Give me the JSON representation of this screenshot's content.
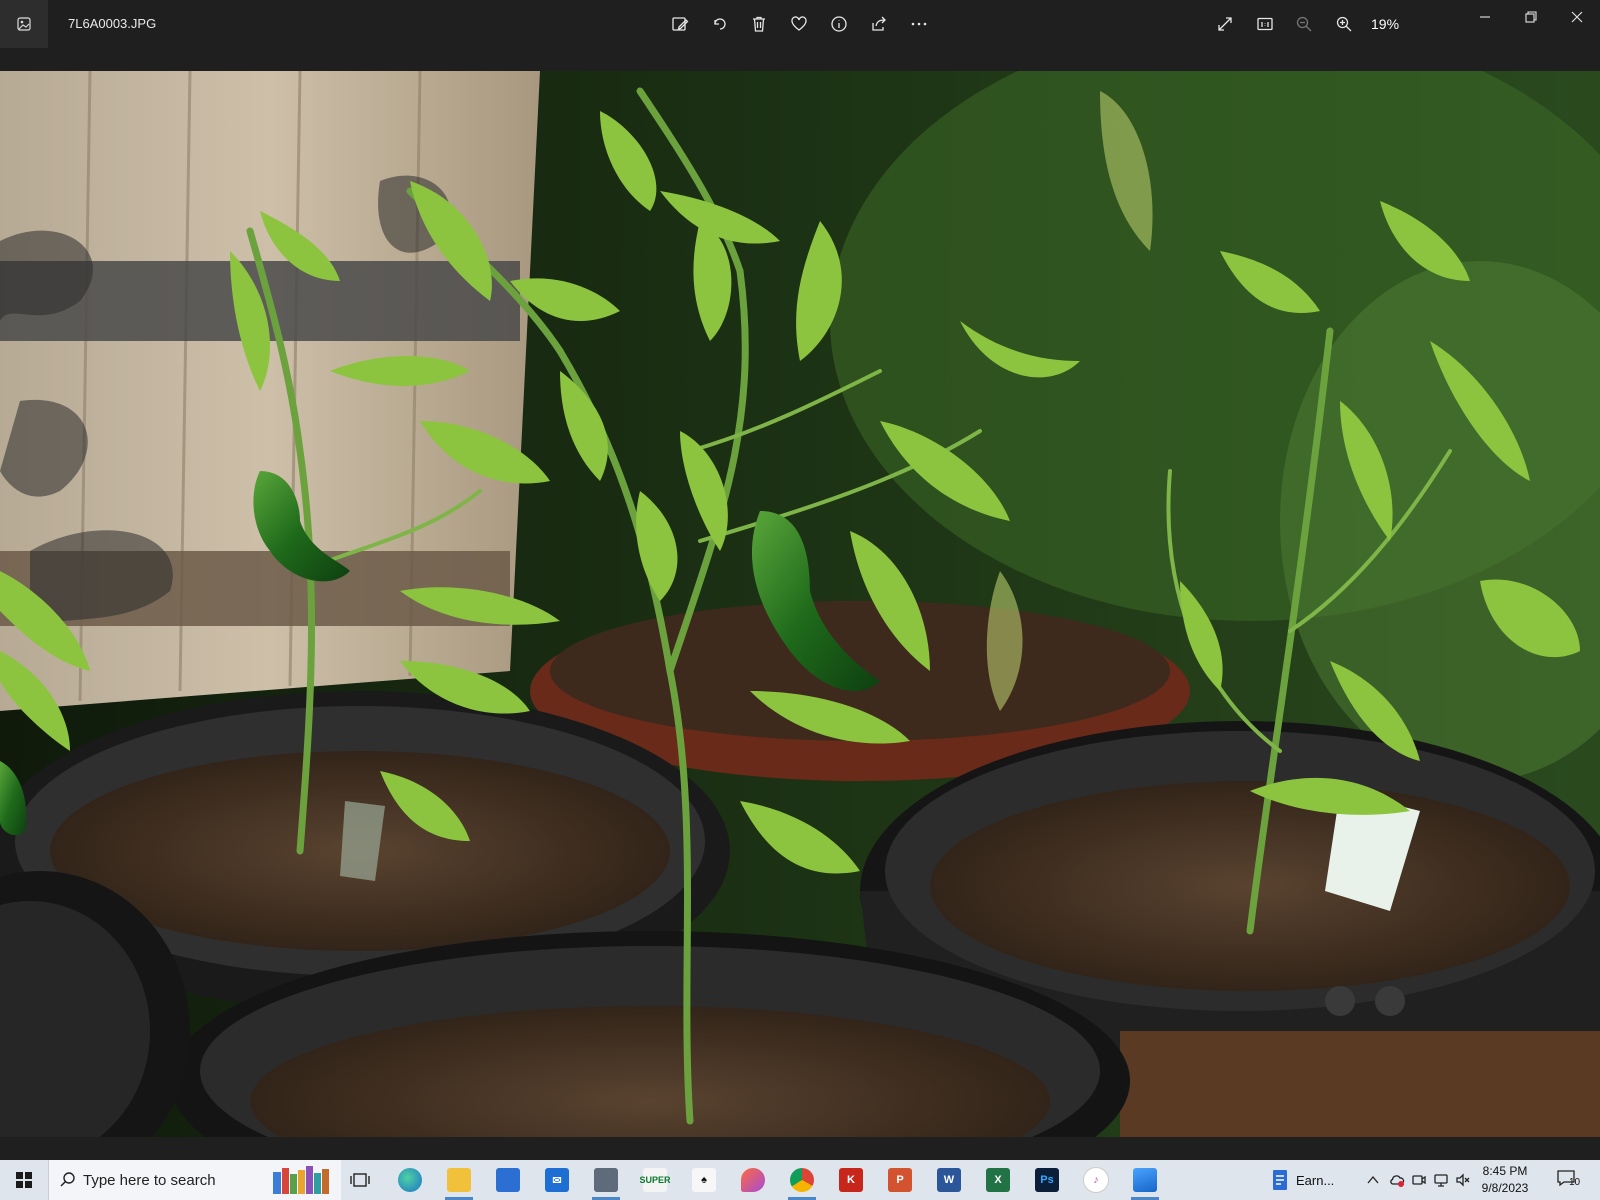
{
  "window": {
    "file_name": "7L6A0003.JPG",
    "zoom_level": "19%"
  },
  "toolbar": {
    "commands": [
      "edit-image",
      "rotate",
      "delete",
      "favorite",
      "file-info",
      "share",
      "see-more"
    ],
    "view_commands": [
      "full-screen",
      "actual-size",
      "zoom-out",
      "zoom-in"
    ]
  },
  "taskbar": {
    "search_placeholder": "Type here to search",
    "running_app_label": "Earn...",
    "clock_time": "8:45 PM",
    "clock_date": "9/8/2023",
    "notification_count": "10",
    "super_icon_text": "SUPER"
  },
  "colors": {
    "titlebar": "#1f1f1f",
    "taskbar": "#dfe5ec",
    "accent": "#4a86c8"
  }
}
